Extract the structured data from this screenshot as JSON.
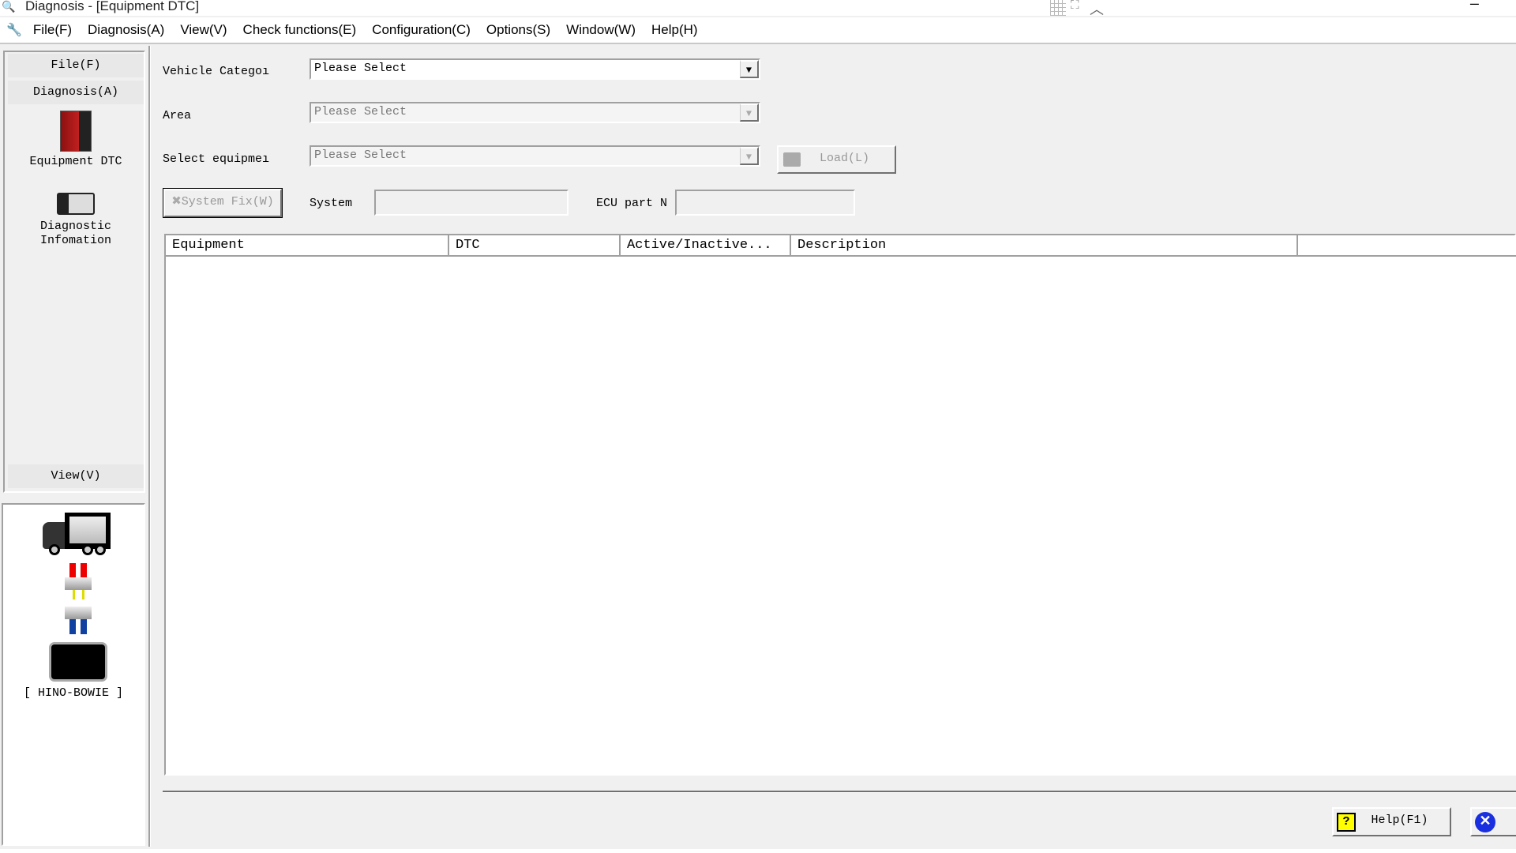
{
  "window": {
    "title": "Diagnosis - [Equipment DTC]"
  },
  "menu": [
    "File(F)",
    "Diagnosis(A)",
    "View(V)",
    "Check functions(E)",
    "Configuration(C)",
    "Options(S)",
    "Window(W)",
    "Help(H)"
  ],
  "nav": {
    "file": "File(F)",
    "diagnosis": "Diagnosis(A)",
    "items": [
      {
        "label": "Equipment DTC",
        "icon": "equipment-dtc-icon"
      },
      {
        "label": "Diagnostic\nInfomation",
        "icon": "diagnostic-info-icon"
      }
    ],
    "view": "View(V)"
  },
  "connection": {
    "label": "[ HINO-BOWIE ]"
  },
  "form": {
    "vehicle_category": {
      "label": "Vehicle Categoı",
      "value": "Please Select"
    },
    "area": {
      "label": "Area",
      "value": "Please Select"
    },
    "select_equipment": {
      "label": "Select equipmeı",
      "value": "Please Select"
    },
    "load": "Load(L)",
    "system_fix": "System Fix(W)",
    "system": {
      "label": "System",
      "value": ""
    },
    "ecu_part": {
      "label": "ECU part N",
      "value": ""
    }
  },
  "table": {
    "columns": [
      "Equipment",
      "DTC",
      "Active/Inactive...",
      "Description"
    ],
    "rows": []
  },
  "footer": {
    "help": "Help(F1)"
  }
}
